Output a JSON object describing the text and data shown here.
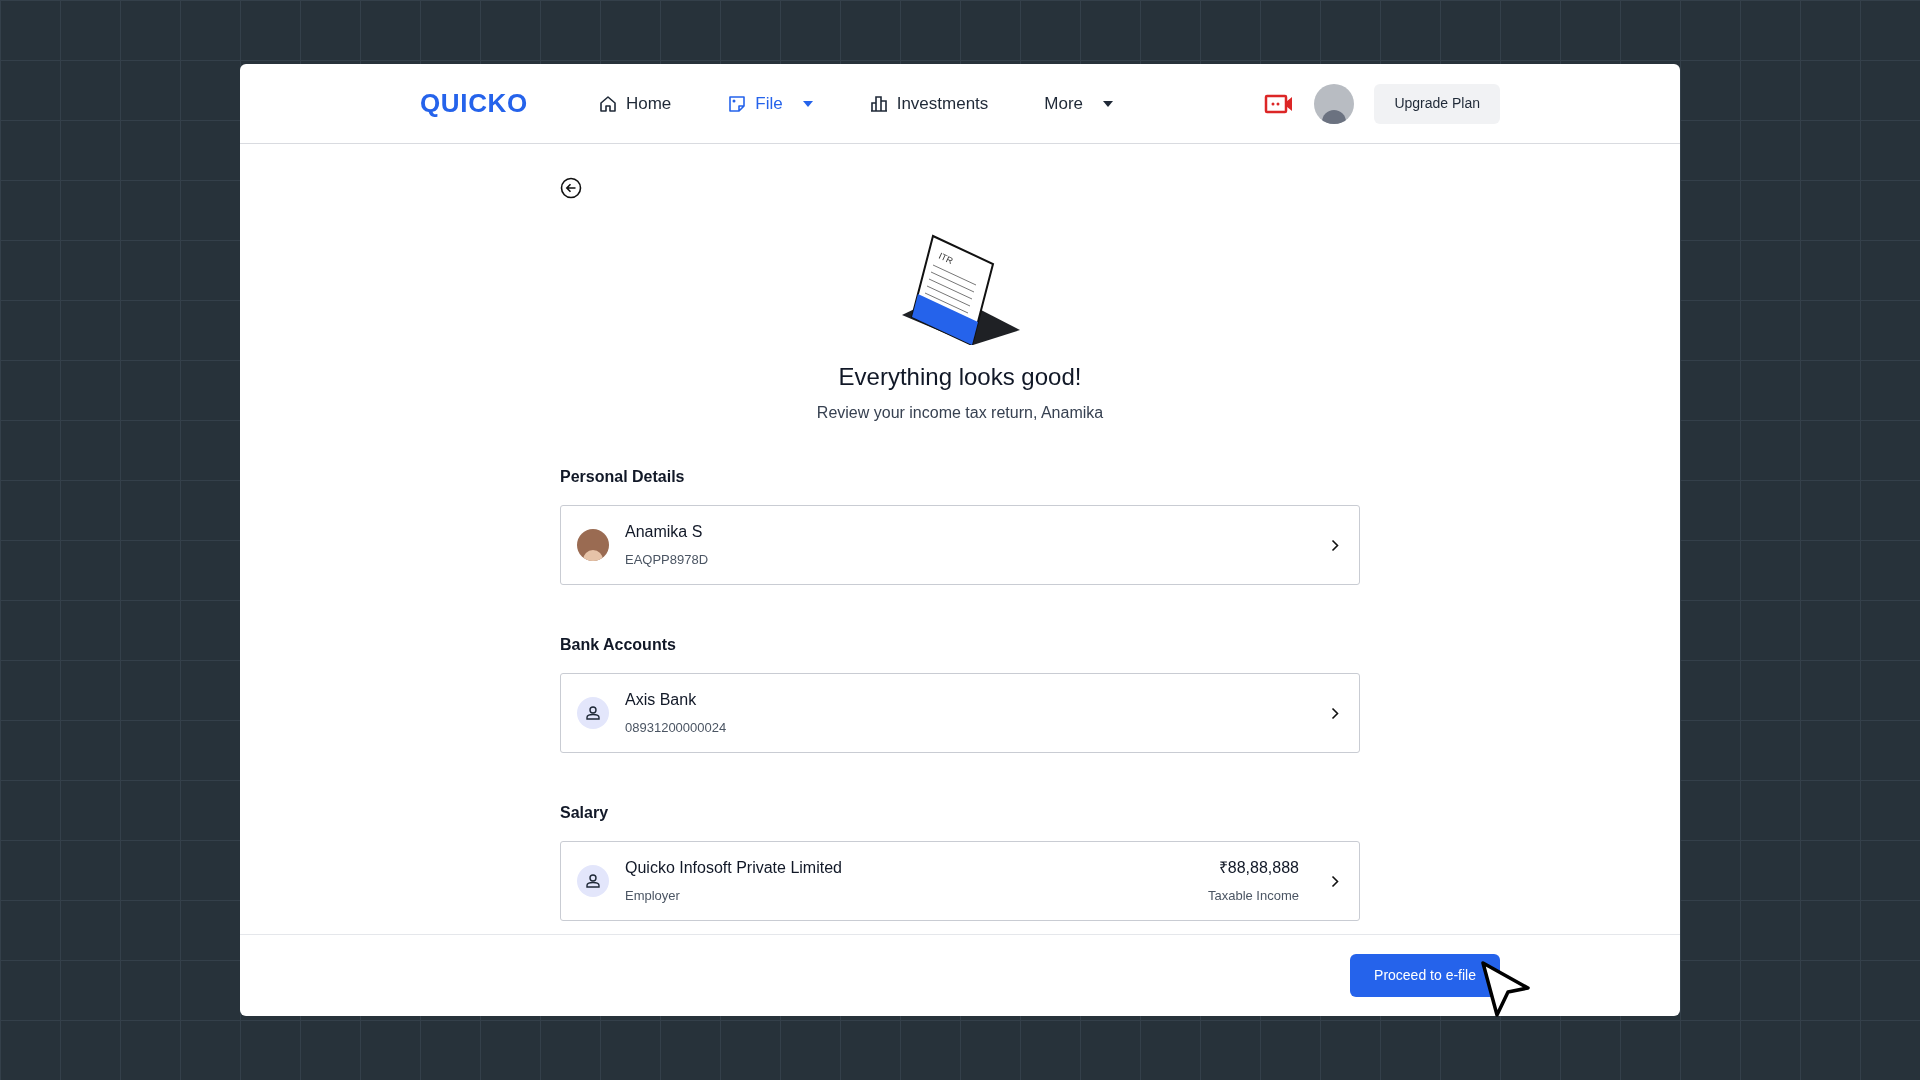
{
  "header": {
    "logo": "QUICKO",
    "nav": [
      {
        "label": "Home",
        "kind": "home",
        "selected": false,
        "has_menu": false
      },
      {
        "label": "File",
        "kind": "file",
        "selected": true,
        "has_menu": true
      },
      {
        "label": "Investments",
        "kind": "chart",
        "selected": false,
        "has_menu": false
      },
      {
        "label": "More",
        "kind": "none",
        "selected": false,
        "has_menu": true
      }
    ],
    "upgrade_button": "Upgrade Plan"
  },
  "hero": {
    "badge": "ITR",
    "title": "Everything looks good!",
    "subtitle": "Review your income tax return, Anamika"
  },
  "sections": [
    {
      "heading": "Personal Details",
      "rows": [
        {
          "kind": "photo",
          "title": "Anamika S",
          "subtitle": "EAQPP8978D"
        }
      ]
    },
    {
      "heading": "Bank Accounts",
      "rows": [
        {
          "kind": "person",
          "title": "Axis Bank",
          "subtitle": "08931200000024"
        }
      ]
    },
    {
      "heading": "Salary",
      "rows": [
        {
          "kind": "person",
          "title": "Quicko Infosoft Private Limited",
          "subtitle": "Employer",
          "amount": "₹88,88,888",
          "amount_label": "Taxable Income"
        }
      ]
    }
  ],
  "footer": {
    "primary_button": "Proceed to e-file"
  }
}
